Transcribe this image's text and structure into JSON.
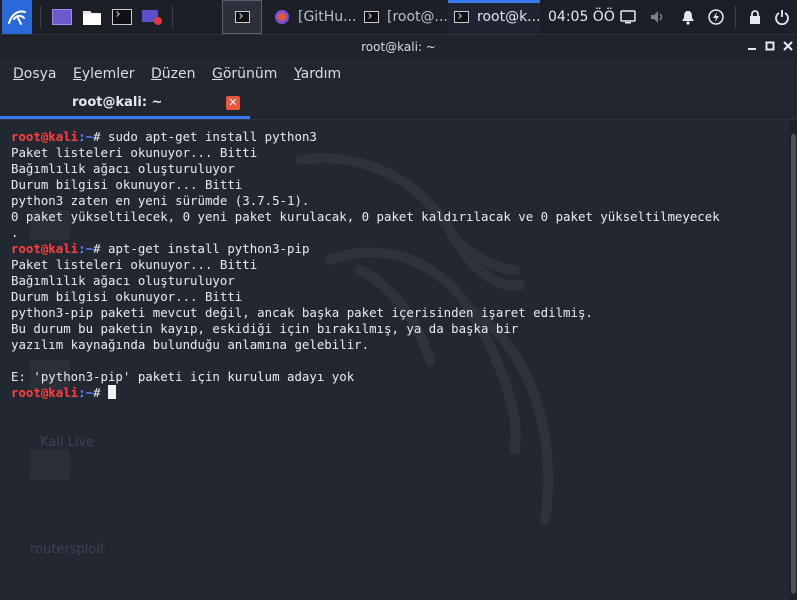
{
  "panel": {
    "launcher_icons": [
      "kali-menu-icon",
      "workspace-icon",
      "files-icon",
      "terminal-icon",
      "screen-recorder-icon"
    ],
    "tasks": [
      {
        "label": "",
        "icon": "terminal-icon",
        "active": false
      },
      {
        "label": "[GitHu...",
        "icon": "firefox-icon",
        "active": false
      },
      {
        "label": "[root@...",
        "icon": "terminal-icon",
        "active": false
      },
      {
        "label": "root@k...",
        "icon": "terminal-icon",
        "active": true
      }
    ],
    "clock": "04:05 ÖÖ",
    "tray_icons": [
      "display-icon",
      "volume-icon",
      "notifications-icon",
      "power-manager-icon",
      "lock-icon",
      "power-icon"
    ]
  },
  "window": {
    "title": "root@kali: ~",
    "controls": [
      "minimize",
      "maximize",
      "close"
    ]
  },
  "menubar": {
    "items": [
      "Dosya",
      "Eylemler",
      "Düzen",
      "Görünüm",
      "Yardım"
    ]
  },
  "tab": {
    "label": "root@kali: ~"
  },
  "desktop_ghosts": [
    "Kali Live",
    "routersploit"
  ],
  "terminal": {
    "prompt_user": "root@kali",
    "prompt_path": ":~",
    "prompt_symbol": "# ",
    "lines": [
      {
        "type": "cmd",
        "text": "sudo apt-get install python3"
      },
      {
        "type": "out",
        "text": "Paket listeleri okunuyor... Bitti"
      },
      {
        "type": "out",
        "text": "Bağımlılık ağacı oluşturuluyor"
      },
      {
        "type": "out",
        "text": "Durum bilgisi okunuyor... Bitti"
      },
      {
        "type": "out",
        "text": "python3 zaten en yeni sürümde (3.7.5-1)."
      },
      {
        "type": "out",
        "text": "0 paket yükseltilecek, 0 yeni paket kurulacak, 0 paket kaldırılacak ve 0 paket yükseltilmeyecek"
      },
      {
        "type": "out",
        "text": "."
      },
      {
        "type": "cmd",
        "text": "apt-get install python3-pip"
      },
      {
        "type": "out",
        "text": "Paket listeleri okunuyor... Bitti"
      },
      {
        "type": "out",
        "text": "Bağımlılık ağacı oluşturuluyor"
      },
      {
        "type": "out",
        "text": "Durum bilgisi okunuyor... Bitti"
      },
      {
        "type": "out",
        "text": "python3-pip paketi mevcut değil, ancak başka paket içerisinden işaret edilmiş."
      },
      {
        "type": "out",
        "text": "Bu durum bu paketin kayıp, eskidiği için bırakılmış, ya da başka bir"
      },
      {
        "type": "out",
        "text": "yazılım kaynağında bulunduğu anlamına gelebilir."
      },
      {
        "type": "out",
        "text": ""
      },
      {
        "type": "out",
        "text": "E: 'python3-pip' paketi için kurulum adayı yok"
      },
      {
        "type": "prompt",
        "text": ""
      }
    ]
  },
  "colors": {
    "prompt_user": "#ff3f3f",
    "prompt_path": "#5a8cff",
    "accent": "#367bf0",
    "close_button": "#e9573f"
  }
}
